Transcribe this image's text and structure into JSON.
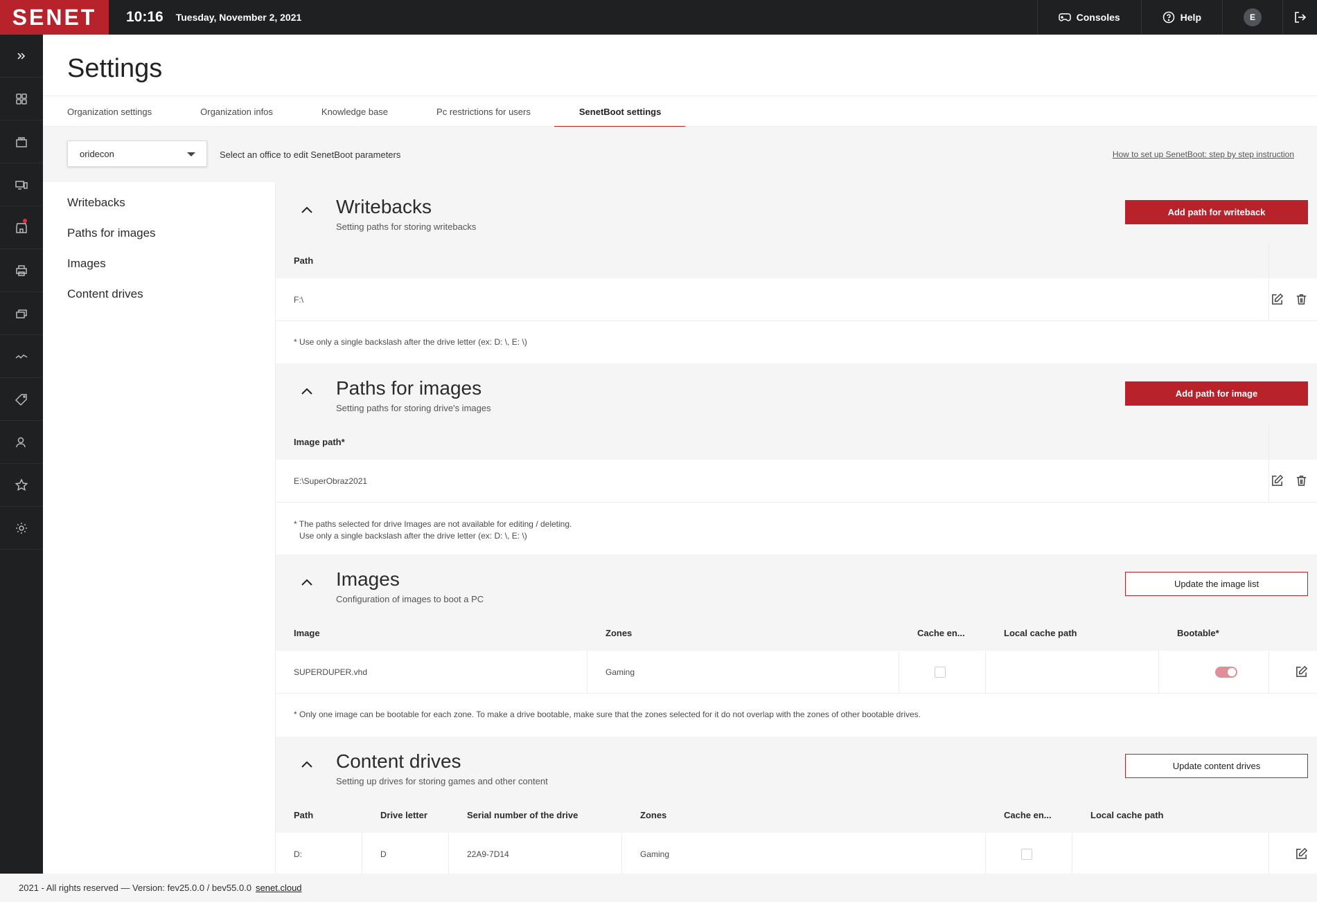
{
  "topbar": {
    "logo": "SENET",
    "time": "10:16",
    "date": "Tuesday, November 2, 2021",
    "consoles_label": "Consoles",
    "help_label": "Help",
    "avatar_letter": "E"
  },
  "sidebar": {
    "items": [
      "expand-icon",
      "dashboard-icon",
      "shop-icon",
      "computers-icon",
      "store-icon",
      "print-icon",
      "layers-icon",
      "activity-icon",
      "tag-icon",
      "users-icon",
      "star-icon",
      "settings-icon"
    ]
  },
  "page": {
    "title": "Settings",
    "tabs": [
      "Organization settings",
      "Organization infos",
      "Knowledge base",
      "Pc restrictions for users",
      "SenetBoot settings"
    ],
    "active_tab": "SenetBoot settings"
  },
  "office": {
    "selected": "oridecon",
    "hint": "Select an office to edit SenetBoot parameters",
    "howto_link": "How to set up SenetBoot: step by step instruction"
  },
  "leftnav": [
    "Writebacks",
    "Paths for images",
    "Images",
    "Content drives"
  ],
  "writebacks": {
    "title": "Writebacks",
    "subtitle": "Setting paths for storing writebacks",
    "button": "Add path for writeback",
    "col_path": "Path",
    "rows": [
      "F:\\"
    ],
    "note": "* Use only a single backslash after the drive letter (ex: D: \\, E: \\)"
  },
  "paths": {
    "title": "Paths for images",
    "subtitle": "Setting paths for storing drive's images",
    "button": "Add path for image",
    "col_path": "Image path*",
    "rows": [
      "E:\\SuperObraz2021"
    ],
    "note_line1": "* The paths selected for drive Images are not available for editing / deleting.",
    "note_line2": "Use only a single backslash after the drive letter (ex: D: \\, E: \\)"
  },
  "images": {
    "title": "Images",
    "subtitle": "Configuration of images to boot a PC",
    "button": "Update the image list",
    "columns": [
      "Image",
      "Zones",
      "Cache en...",
      "Local cache path",
      "Bootable*"
    ],
    "row": {
      "image": "SUPERDUPER.vhd",
      "zones": "Gaming",
      "cache": false,
      "local_cache_path": "",
      "bootable": true
    },
    "note": "* Only one image can be bootable for each zone. To make a drive bootable, make sure that the zones selected for it do not overlap with the zones of other bootable drives."
  },
  "content_drives": {
    "title": "Content drives",
    "subtitle": "Setting up drives for storing games and other content",
    "button": "Update content drives",
    "columns": [
      "Path",
      "Drive letter",
      "Serial number of the drive",
      "Zones",
      "Cache en...",
      "Local cache path"
    ],
    "row": {
      "path": "D:",
      "drive_letter": "D",
      "serial": "22A9-7D14",
      "zones": "Gaming",
      "cache": false,
      "local_cache_path": ""
    }
  },
  "footer": {
    "text": "2021 - All rights reserved — Version: fev25.0.0 / bev55.0.0",
    "link": "senet.cloud"
  },
  "colors": {
    "accent": "#b8222a",
    "topbar": "#1e2022"
  }
}
